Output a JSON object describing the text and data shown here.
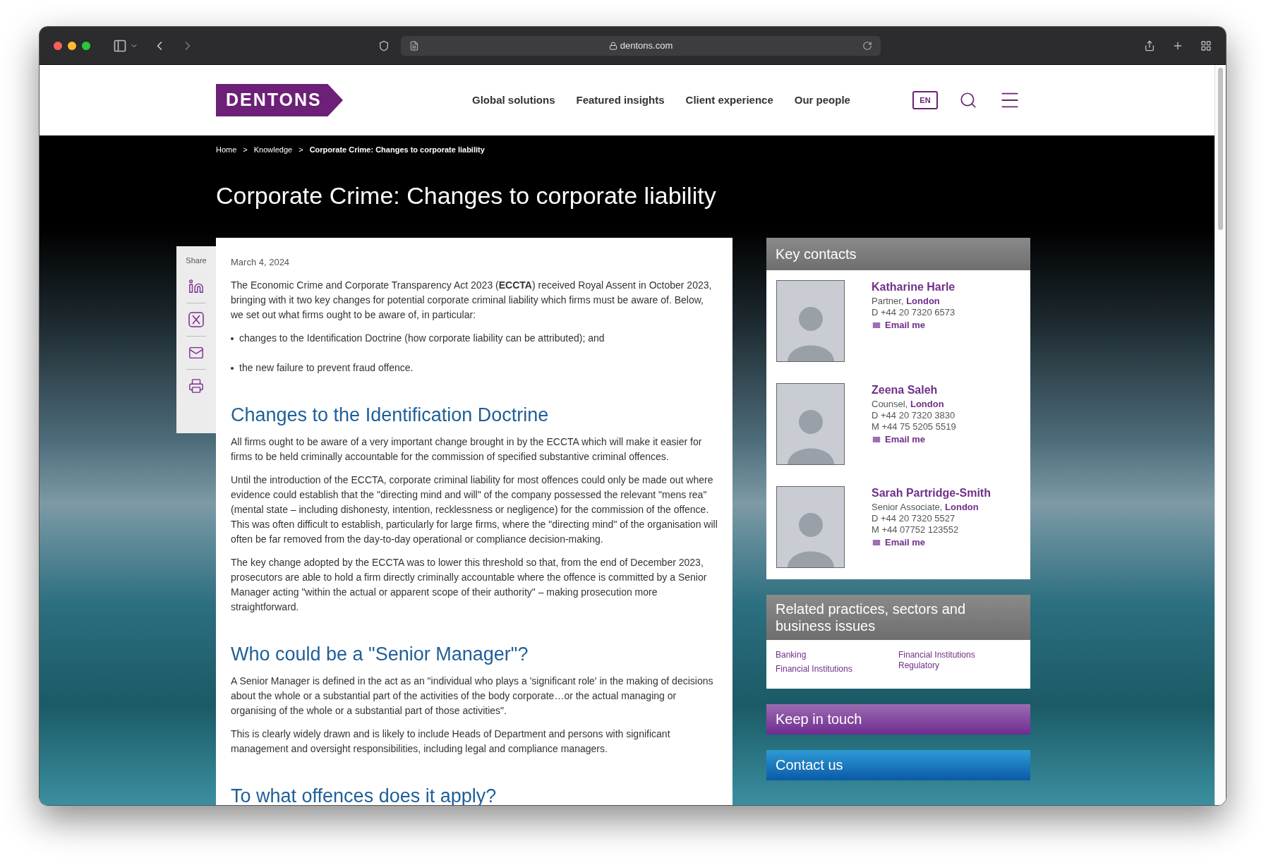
{
  "browser": {
    "url": "dentons.com"
  },
  "header": {
    "logo": "DENTONS",
    "nav": [
      "Global solutions",
      "Featured insights",
      "Client experience",
      "Our people"
    ],
    "language": "EN"
  },
  "breadcrumb": [
    "Home",
    "Knowledge",
    "Corporate Crime: Changes to corporate liability"
  ],
  "breadcrumb_separator": ">",
  "title": "Corporate Crime: Changes to corporate liability",
  "share": {
    "label": "Share"
  },
  "article": {
    "date": "March 4, 2024",
    "intro": "The Economic Crime and Corporate Transparency Act 2023 (**ECCTA**) received Royal Assent in October 2023, bringing with it two key changes for potential corporate criminal liability which firms must be aware of. Below, we set out what firms ought to be aware of, in particular:",
    "bullets": [
      "changes to the Identification Doctrine (how corporate liability can be attributed); and",
      "the new failure to prevent fraud offence."
    ],
    "sections": [
      {
        "heading": "Changes to the Identification Doctrine",
        "paragraphs": [
          "All firms ought to be aware of a very important change brought in by the ECCTA which will make it easier for firms to be held criminally accountable for the commission of specified substantive criminal offences.",
          "Until the introduction of the ECCTA, corporate criminal liability for most offences could only be made out where evidence could establish that the \"directing mind and will\" of the company possessed the relevant \"mens rea\" (mental state – including dishonesty, intention, recklessness or negligence) for the commission of the offence. This was often difficult to establish, particularly for large firms, where the \"directing mind\" of the organisation will often be far removed from the day-to-day operational or compliance decision-making.",
          "The key change adopted by the ECCTA was to lower this threshold so that, from the end of December 2023, prosecutors are able to hold a firm directly criminally accountable where the offence is committed by a Senior Manager acting \"within the actual or apparent scope of their authority\" – making prosecution more straightforward."
        ]
      },
      {
        "heading": "Who could be a \"Senior Manager\"?",
        "paragraphs": [
          "A Senior Manager is defined in the act as an \"individual who plays a 'significant role' in the making of decisions about the whole or a substantial part of the activities of the body corporate…or the actual managing or organising of the whole or a substantial part of those activities\".",
          "This is clearly widely drawn and is likely to include Heads of Department and persons with significant management and oversight responsibilities, including legal and compliance managers."
        ]
      },
      {
        "heading": "To what offences does it apply?"
      }
    ]
  },
  "key_contacts": {
    "title": "Key contacts",
    "contacts": [
      {
        "name": "Katharine Harle",
        "role": "Partner,",
        "office": "London",
        "phones": [
          "D +44 20 7320 6573"
        ],
        "email": "Email me"
      },
      {
        "name": "Zeena Saleh",
        "role": "Counsel,",
        "office": "London",
        "phones": [
          "D +44 20 7320 3830",
          "M +44 75 5205 5519"
        ],
        "email": "Email me"
      },
      {
        "name": "Sarah Partridge-Smith",
        "role": "Senior Associate,",
        "office": "London",
        "phones": [
          "D +44 20 7320 5527",
          "M +44 07752 123552"
        ],
        "email": "Email me"
      }
    ]
  },
  "related": {
    "title": "Related practices, sectors and business issues",
    "columns": [
      [
        "Banking",
        "Financial Institutions"
      ],
      [
        "Financial Institutions Regulatory"
      ]
    ]
  },
  "actions": [
    {
      "kind": "purple",
      "label": "Keep in touch"
    },
    {
      "kind": "blue",
      "label": "Contact us"
    }
  ]
}
